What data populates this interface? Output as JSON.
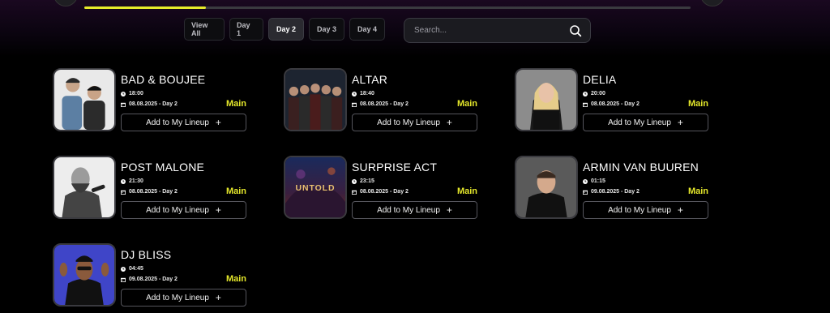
{
  "progress": 0.2,
  "colors": {
    "accent": "#e5e82b",
    "background": "#000000",
    "tab_active": "#2a2a30"
  },
  "day_tabs": [
    {
      "label": "View All",
      "active": false
    },
    {
      "label": "Day 1",
      "active": false
    },
    {
      "label": "Day 2",
      "active": true
    },
    {
      "label": "Day 3",
      "active": false
    },
    {
      "label": "Day 4",
      "active": false
    }
  ],
  "search": {
    "placeholder": "Search...",
    "icon": "search-icon"
  },
  "lineup_button_label": "Add to My Lineup",
  "plus_symbol": "+",
  "artists": [
    {
      "name": "BAD & BOUJEE",
      "time": "18:00",
      "date": "08.08.2025 - Day 2",
      "stage": "Main"
    },
    {
      "name": "ALTAR",
      "time": "18:40",
      "date": "08.08.2025 - Day 2",
      "stage": "Main"
    },
    {
      "name": "DELIA",
      "time": "20:00",
      "date": "08.08.2025 - Day 2",
      "stage": "Main"
    },
    {
      "name": "POST MALONE",
      "time": "21:30",
      "date": "08.08.2025 - Day 2",
      "stage": "Main"
    },
    {
      "name": "SURPRISE ACT",
      "time": "23:15",
      "date": "08.08.2025 - Day 2",
      "stage": "Main",
      "poster_text": "UNTOLD"
    },
    {
      "name": "ARMIN VAN BUUREN",
      "time": "01:15",
      "date": "09.08.2025 - Day 2",
      "stage": "Main"
    },
    {
      "name": "DJ BLISS",
      "time": "04:45",
      "date": "09.08.2025 - Day 2",
      "stage": "Main"
    }
  ]
}
